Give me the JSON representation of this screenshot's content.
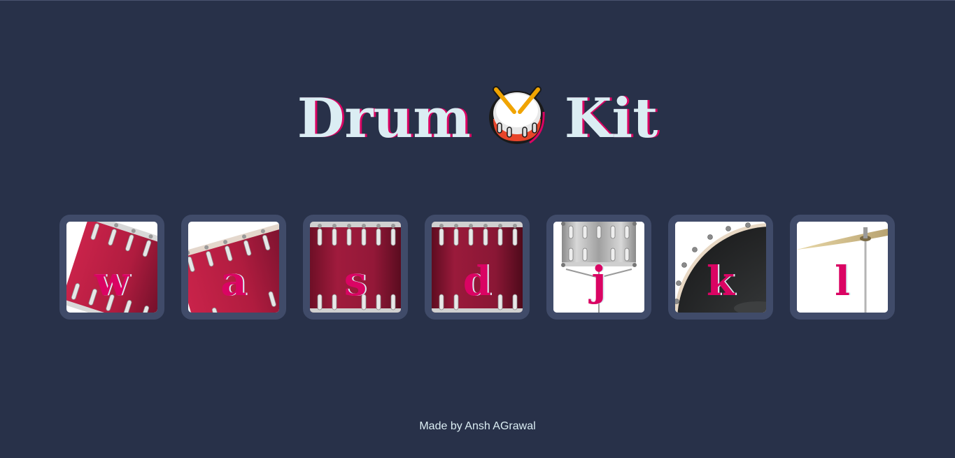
{
  "page": {
    "title_word_1": "Drum",
    "title_emoji": "drum-emoji",
    "title_word_2": "Kit",
    "footer_text": "Made by Ansh AGrawal"
  },
  "colors": {
    "background": "#283149",
    "tile_border": "#404b69",
    "text_light": "#dbedf3",
    "accent_pink": "#da0463"
  },
  "drums": [
    {
      "key": "w",
      "instrument": "tom-1"
    },
    {
      "key": "a",
      "instrument": "tom-2"
    },
    {
      "key": "s",
      "instrument": "tom-3"
    },
    {
      "key": "d",
      "instrument": "tom-4"
    },
    {
      "key": "j",
      "instrument": "snare"
    },
    {
      "key": "k",
      "instrument": "kick-bass"
    },
    {
      "key": "l",
      "instrument": "crash"
    }
  ]
}
